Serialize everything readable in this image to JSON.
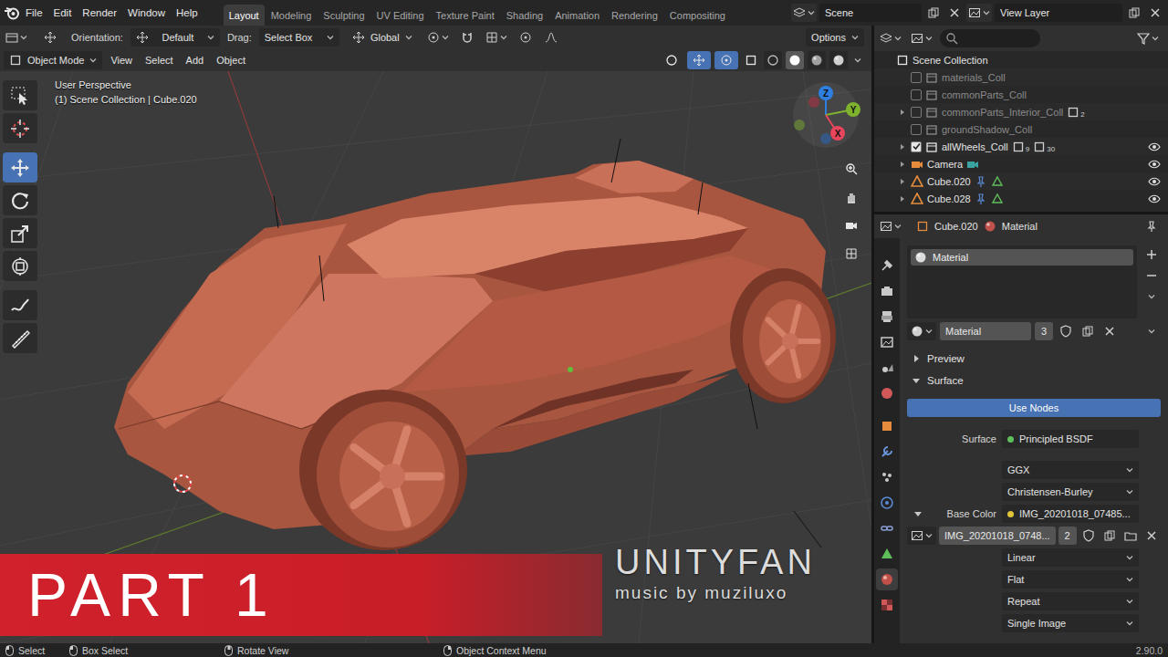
{
  "window": {
    "menus": [
      "File",
      "Edit",
      "Render",
      "Window",
      "Help"
    ],
    "scene": "Scene",
    "view_layer": "View Layer"
  },
  "workspaces": [
    {
      "label": "Layout",
      "selected": true
    },
    {
      "label": "Modeling",
      "selected": false
    },
    {
      "label": "Sculpting",
      "selected": false
    },
    {
      "label": "UV Editing",
      "selected": false
    },
    {
      "label": "Texture Paint",
      "selected": false
    },
    {
      "label": "Shading",
      "selected": false
    },
    {
      "label": "Animation",
      "selected": false
    },
    {
      "label": "Rendering",
      "selected": false
    },
    {
      "label": "Compositing",
      "selected": false
    }
  ],
  "tool_settings": {
    "orientation_label": "Orientation:",
    "orientation": "Default",
    "drag_label": "Drag:",
    "drag": "Select Box",
    "transform": "Global",
    "options": "Options"
  },
  "viewport_header": {
    "mode": "Object Mode",
    "menus": [
      "View",
      "Select",
      "Add",
      "Object"
    ],
    "toggles": [
      {
        "kind": "visibility",
        "on": false
      },
      {
        "kind": "gizmos",
        "on": true
      },
      {
        "kind": "overlays",
        "on": true
      },
      {
        "kind": "xray",
        "on": false
      }
    ],
    "shading": [
      {
        "kind": "wireframe",
        "selected": false
      },
      {
        "kind": "solid",
        "selected": true
      },
      {
        "kind": "material",
        "selected": false
      },
      {
        "kind": "rendered",
        "selected": false
      }
    ]
  },
  "viewport": {
    "view_name": "User Perspective",
    "context": "(1) Scene Collection | Cube.020",
    "gizmo_axes": [
      {
        "label": "Z",
        "color": "#2f7fe0"
      },
      {
        "label": "Y",
        "color": "#7fb32e"
      },
      {
        "label": "X",
        "color": "#e8465c"
      }
    ]
  },
  "tools": [
    {
      "kind": "select",
      "selected": false
    },
    {
      "kind": "cursor",
      "selected": false
    },
    {
      "kind": "move",
      "selected": true
    },
    {
      "kind": "rotate",
      "selected": false
    },
    {
      "kind": "scale",
      "selected": false
    },
    {
      "kind": "transform",
      "selected": false
    },
    {
      "kind": "annotate",
      "selected": false
    },
    {
      "kind": "measure",
      "selected": false
    }
  ],
  "overlay": {
    "banner": "PART 1",
    "brand": "UNITYFAN",
    "credit": "music by muziluxo"
  },
  "outliner": {
    "root": "Scene Collection",
    "items": [
      {
        "label": "materials_Coll",
        "kind": "collection",
        "excluded": true,
        "has_children": false,
        "badges": [],
        "visible": false
      },
      {
        "label": "commonParts_Coll",
        "kind": "collection",
        "excluded": true,
        "has_children": false,
        "badges": [],
        "visible": false
      },
      {
        "label": "commonParts_Interior_Coll",
        "kind": "collection",
        "excluded": true,
        "has_children": true,
        "badges": [
          "2"
        ],
        "visible": false
      },
      {
        "label": "groundShadow_Coll",
        "kind": "collection",
        "excluded": true,
        "has_children": false,
        "badges": [],
        "visible": false
      },
      {
        "label": "allWheels_Coll",
        "kind": "collection",
        "excluded": false,
        "has_children": true,
        "badges": [
          "9",
          "30"
        ],
        "visible": true
      },
      {
        "label": "Camera",
        "kind": "camera",
        "excluded": false,
        "has_children": true,
        "badges": [],
        "visible": true
      },
      {
        "label": "Cube.020",
        "kind": "mesh",
        "excluded": false,
        "has_children": true,
        "badges": [],
        "visible": true
      },
      {
        "label": "Cube.028",
        "kind": "mesh",
        "excluded": false,
        "has_children": true,
        "badges": [],
        "visible": true
      }
    ]
  },
  "properties": {
    "object": "Cube.020",
    "context": "Material",
    "tabs": [
      {
        "kind": "tool",
        "selected": false
      },
      {
        "kind": "render",
        "selected": false
      },
      {
        "kind": "output",
        "selected": false
      },
      {
        "kind": "view_layer",
        "selected": false
      },
      {
        "kind": "scene",
        "selected": false
      },
      {
        "kind": "world",
        "selected": false
      },
      {
        "kind": "object",
        "selected": false
      },
      {
        "kind": "modifiers",
        "selected": false
      },
      {
        "kind": "particles",
        "selected": false
      },
      {
        "kind": "physics",
        "selected": false
      },
      {
        "kind": "constraints",
        "selected": false
      },
      {
        "kind": "data",
        "selected": false
      },
      {
        "kind": "material",
        "selected": true
      },
      {
        "kind": "texture",
        "selected": false
      }
    ],
    "slots": [
      {
        "label": "Material",
        "selected": true
      }
    ],
    "material": "Material",
    "material_users": "3",
    "panels": [
      {
        "label": "Preview",
        "expanded": false
      },
      {
        "label": "Surface",
        "expanded": true
      }
    ],
    "use_nodes": "Use Nodes",
    "surface_label": "Surface",
    "surface": "Principled BSDF",
    "distribution": "GGX",
    "subsurface": "Christensen-Burley",
    "base_color_label": "Base Color",
    "base_color_expanded": true,
    "base_color": "IMG_20201018_07485...",
    "image": "IMG_20201018_0748...",
    "image_users": "2",
    "image_settings": [
      "Linear",
      "Flat",
      "Repeat",
      "Single Image"
    ]
  },
  "status_bar": {
    "hints": [
      "Select",
      "Box Select",
      "Rotate View",
      "Object Context Menu"
    ],
    "version": "2.90.0"
  }
}
